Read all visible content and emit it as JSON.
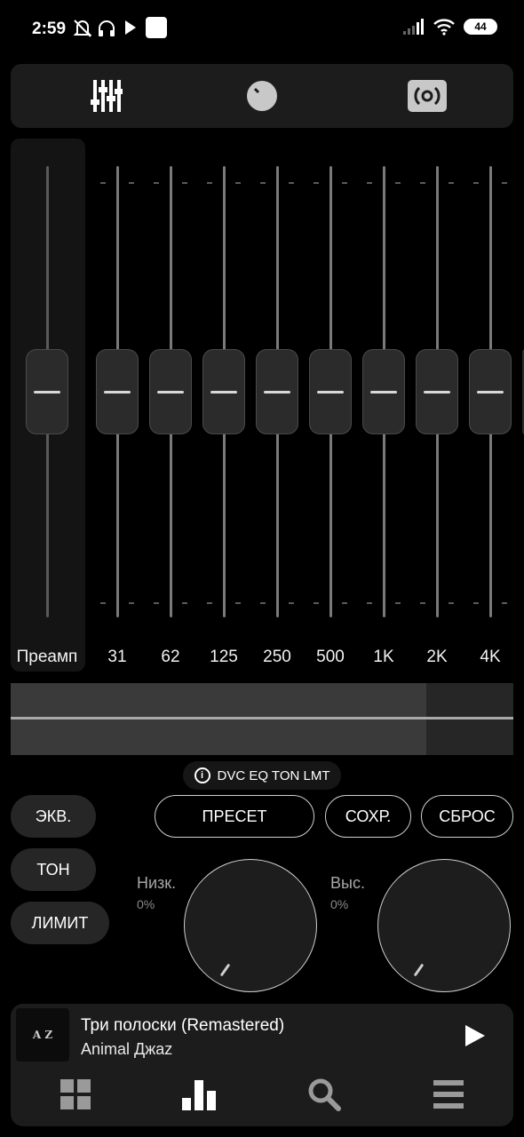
{
  "status": {
    "time": "2:59",
    "battery": "44"
  },
  "tabs": [
    {
      "icon": "equalizer-sliders-icon"
    },
    {
      "icon": "knob-icon"
    },
    {
      "icon": "speaker-surround-icon"
    }
  ],
  "eq": {
    "preamp_label": "Преамп",
    "bands": [
      "31",
      "62",
      "125",
      "250",
      "500",
      "1K",
      "2K",
      "4K"
    ],
    "gain_db": [
      0,
      0,
      0,
      0,
      0,
      0,
      0,
      0,
      0
    ]
  },
  "spectrum": {
    "fill_fraction": 0.826
  },
  "info": {
    "icon": "info-icon",
    "text": "DVC EQ TON LMT"
  },
  "toggles": {
    "eq": "ЭКВ.",
    "tone": "ТОН",
    "limit": "ЛИМИТ"
  },
  "actions": {
    "preset": "ПРЕСЕТ",
    "save": "СОХР.",
    "reset": "СБРОС"
  },
  "tone": {
    "low_label": "Низк.",
    "low_value": "0%",
    "high_label": "Выс.",
    "high_value": "0%"
  },
  "player": {
    "cover_text": "A Z",
    "title": "Три полоски (Remastered)",
    "artist": "Animal Джаz"
  },
  "nav": [
    {
      "icon": "grid-icon"
    },
    {
      "icon": "equalizer-bars-icon"
    },
    {
      "icon": "search-icon"
    },
    {
      "icon": "queue-list-icon"
    }
  ]
}
